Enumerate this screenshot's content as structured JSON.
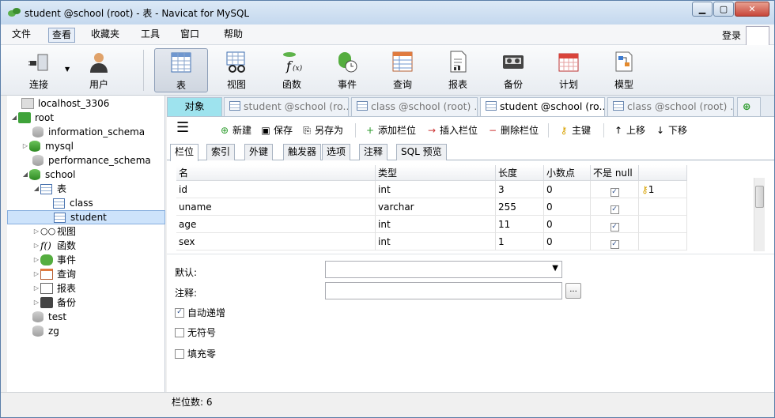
{
  "window": {
    "title": "student @school (root) - 表 - Navicat for MySQL"
  },
  "menu": {
    "items": [
      "文件",
      "查看",
      "收藏夹",
      "工具",
      "窗口",
      "帮助"
    ],
    "login": "登录"
  },
  "toolbar": {
    "items": [
      {
        "label": "连接",
        "icon": "connection-icon"
      },
      {
        "label": "用户",
        "icon": "user-icon"
      },
      {
        "label": "表",
        "icon": "table-icon"
      },
      {
        "label": "视图",
        "icon": "view-icon"
      },
      {
        "label": "函数",
        "icon": "function-icon"
      },
      {
        "label": "事件",
        "icon": "event-icon"
      },
      {
        "label": "查询",
        "icon": "query-icon"
      },
      {
        "label": "报表",
        "icon": "report-icon"
      },
      {
        "label": "备份",
        "icon": "backup-icon"
      },
      {
        "label": "计划",
        "icon": "schedule-icon"
      },
      {
        "label": "模型",
        "icon": "model-icon"
      }
    ]
  },
  "tree": {
    "localhost": "localhost_3306",
    "root": "root",
    "info": "information_schema",
    "mysql": "mysql",
    "perf": "performance_schema",
    "school": "school",
    "tables": "表",
    "class": "class",
    "student": "student",
    "views": "视图",
    "funcs": "函数",
    "events": "事件",
    "queries": "查询",
    "reports": "报表",
    "backups": "备份",
    "test": "test",
    "zg": "zg"
  },
  "tabs": {
    "objects": "对象",
    "t1": "student @school (ro...",
    "t2": "class @school (root) ...",
    "t3": "student @school (ro...",
    "t4": "class @school (root) ..."
  },
  "subtoolbar": {
    "new": "新建",
    "save": "保存",
    "saveas": "另存为",
    "addcol": "添加栏位",
    "inscol": "插入栏位",
    "delcol": "删除栏位",
    "pk": "主键",
    "up": "上移",
    "down": "下移"
  },
  "fieldtabs": [
    "栏位",
    "索引",
    "外键",
    "触发器",
    "选项",
    "注释",
    "SQL 预览"
  ],
  "grid": {
    "headers": [
      "名",
      "类型",
      "长度",
      "小数点",
      "不是 null",
      ""
    ],
    "rows": [
      {
        "name": "id",
        "type": "int",
        "len": "3",
        "dec": "0",
        "nn": true,
        "key": "1"
      },
      {
        "name": "uname",
        "type": "varchar",
        "len": "255",
        "dec": "0",
        "nn": true,
        "key": ""
      },
      {
        "name": "age",
        "type": "int",
        "len": "11",
        "dec": "0",
        "nn": true,
        "key": ""
      },
      {
        "name": "sex",
        "type": "int",
        "len": "1",
        "dec": "0",
        "nn": true,
        "key": ""
      }
    ]
  },
  "props": {
    "default": "默认:",
    "comment": "注释:",
    "autoinc": "自动递增",
    "unsigned": "无符号",
    "zerofill": "填充零",
    "dots": "..."
  },
  "status": {
    "fields": "栏位数: 6"
  }
}
